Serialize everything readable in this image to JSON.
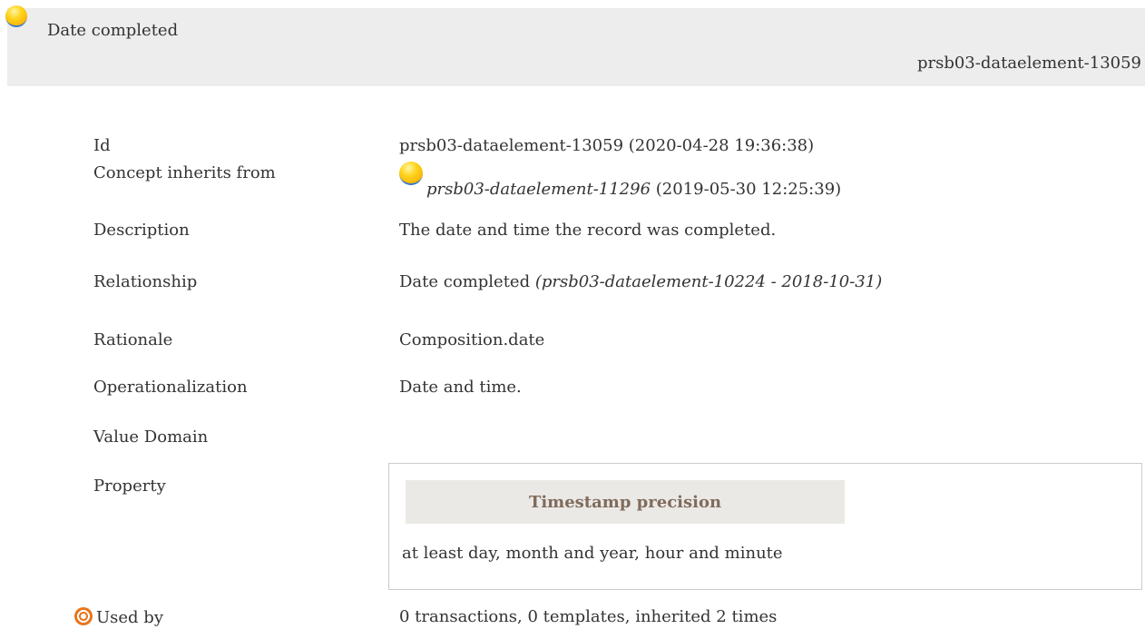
{
  "header": {
    "title": "Date completed",
    "id": "prsb03-dataelement-13059"
  },
  "rows": {
    "id": {
      "label": "Id",
      "value": "prsb03-dataelement-13059 (2020-04-28 19:36:38)"
    },
    "inherits": {
      "label": "Concept inherits from",
      "link": "prsb03-dataelement-11296",
      "date": "(2019-05-30 12:25:39)"
    },
    "description": {
      "label": "Description",
      "value": "The date and time the record was completed."
    },
    "relationship": {
      "label": "Relationship",
      "value": "Date completed",
      "ref": "(prsb03-dataelement-10224 - 2018-10-31)"
    },
    "rationale": {
      "label": "Rationale",
      "value": "Composition.date"
    },
    "operationalization": {
      "label": "Operationalization",
      "value": "Date and time."
    },
    "value_domain": {
      "label": "Value Domain",
      "value": ""
    },
    "property": {
      "label": "Property",
      "heading": "Timestamp precision",
      "value": "at least day, month and year, hour and minute"
    },
    "used_by": {
      "label": "Used by",
      "value": "0 transactions, 0 templates, inherited 2 times"
    }
  },
  "icons": {
    "concept": "yellow-ball-icon",
    "used_by": "target-icon"
  },
  "colors": {
    "header_bg": "#ededed",
    "property_heading_bg": "#ebe9e6",
    "property_heading_text": "#806c5c",
    "ball_yellow": "#ffd21a",
    "used_by_orange": "#e8761b"
  }
}
